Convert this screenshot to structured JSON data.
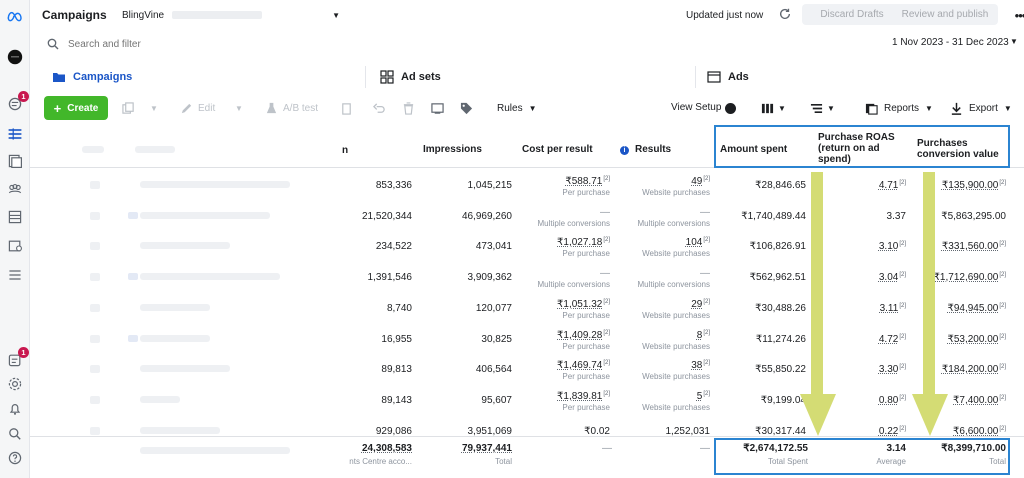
{
  "app": {
    "title": "Campaigns",
    "account": "BlingVine",
    "updated": "Updated just now",
    "discard": "Discard Drafts",
    "review": "Review and publish",
    "colors": {
      "accent": "#1b56c7",
      "create": "#42b72a",
      "highlight": "#2b84d1",
      "arrow": "#d4dc74"
    }
  },
  "sidebar": {
    "notif_badge": "1",
    "bottom_badge": "1"
  },
  "search": {
    "placeholder": "Search and filter",
    "daterange": "1 Nov 2023 - 31 Dec 2023"
  },
  "tabs": [
    {
      "label": "Campaigns"
    },
    {
      "label": "Ad sets"
    },
    {
      "label": "Ads"
    }
  ],
  "toolbar": {
    "create": "Create",
    "edit": "Edit",
    "abtest": "A/B test",
    "rules": "Rules",
    "view_setup": "View Setup",
    "reports": "Reports",
    "export": "Export"
  },
  "table": {
    "headers": {
      "partial": "n",
      "impressions": "Impressions",
      "cpr": "Cost per result",
      "results": "Results",
      "amount": "Amount spent",
      "roas_1": "Purchase ROAS",
      "roas_2": "(return on ad",
      "roas_3": "spend)",
      "pcv_1": "Purchases",
      "pcv_2": "conversion value"
    },
    "rows": [
      {
        "reach": "853,336",
        "impressions": "1,045,215",
        "cpr": "₹588.71",
        "cpr_note": "[2]",
        "cpr_sub": "Per purchase",
        "results": "49",
        "results_note": "[2]",
        "results_sub": "Website purchases",
        "amount": "₹28,846.65",
        "roas": "4.71",
        "roas_note": "[2]",
        "pcv": "₹135,900.00",
        "pcv_note": "[2]"
      },
      {
        "reach": "21,520,344",
        "impressions": "46,969,260",
        "cpr": "—",
        "cpr_note": "",
        "cpr_sub": "Multiple conversions",
        "results": "—",
        "results_note": "",
        "results_sub": "Multiple conversions",
        "amount": "₹1,740,489.44",
        "roas": "3.37",
        "roas_note": "",
        "pcv": "₹5,863,295.00",
        "pcv_note": ""
      },
      {
        "reach": "234,522",
        "impressions": "473,041",
        "cpr": "₹1,027.18",
        "cpr_note": "[2]",
        "cpr_sub": "Per purchase",
        "results": "104",
        "results_note": "[2]",
        "results_sub": "Website purchases",
        "amount": "₹106,826.91",
        "roas": "3.10",
        "roas_note": "[2]",
        "pcv": "₹331,560.00",
        "pcv_note": "[2]"
      },
      {
        "reach": "1,391,546",
        "impressions": "3,909,362",
        "cpr": "—",
        "cpr_note": "",
        "cpr_sub": "Multiple conversions",
        "results": "—",
        "results_note": "",
        "results_sub": "Multiple conversions",
        "amount": "₹562,962.51",
        "roas": "3.04",
        "roas_note": "[2]",
        "pcv": "₹1,712,690.00",
        "pcv_note": "[2]"
      },
      {
        "reach": "8,740",
        "impressions": "120,077",
        "cpr": "₹1,051.32",
        "cpr_note": "[2]",
        "cpr_sub": "Per purchase",
        "results": "29",
        "results_note": "[2]",
        "results_sub": "Website purchases",
        "amount": "₹30,488.26",
        "roas": "3.11",
        "roas_note": "[2]",
        "pcv": "₹94,945.00",
        "pcv_note": "[2]"
      },
      {
        "reach": "16,955",
        "impressions": "30,825",
        "cpr": "₹1,409.28",
        "cpr_note": "[2]",
        "cpr_sub": "Per purchase",
        "results": "8",
        "results_note": "[2]",
        "results_sub": "Website purchases",
        "amount": "₹11,274.26",
        "roas": "4.72",
        "roas_note": "[2]",
        "pcv": "₹53,200.00",
        "pcv_note": "[2]"
      },
      {
        "reach": "89,813",
        "impressions": "406,564",
        "cpr": "₹1,469.74",
        "cpr_note": "[2]",
        "cpr_sub": "Per purchase",
        "results": "38",
        "results_note": "[2]",
        "results_sub": "Website purchases",
        "amount": "₹55,850.22",
        "roas": "3.30",
        "roas_note": "[2]",
        "pcv": "₹184,200.00",
        "pcv_note": "[2]"
      },
      {
        "reach": "89,143",
        "impressions": "95,607",
        "cpr": "₹1,839.81",
        "cpr_note": "[2]",
        "cpr_sub": "Per purchase",
        "results": "5",
        "results_note": "[2]",
        "results_sub": "Website purchases",
        "amount": "₹9,199.04",
        "roas": "0.80",
        "roas_note": "[2]",
        "pcv": "₹7,400.00",
        "pcv_note": "[2]"
      },
      {
        "reach": "929,086",
        "impressions": "3,951,069",
        "cpr": "₹0.02",
        "cpr_note": "",
        "cpr_sub": "",
        "results": "1,252,031",
        "results_note": "",
        "results_sub": "",
        "amount": "₹30,317.44",
        "roas": "0.22",
        "roas_note": "[2]",
        "pcv": "₹6,600.00",
        "pcv_note": "[2]"
      }
    ],
    "totals": {
      "reach": "24,308,583",
      "reach_sub": "nts Centre acco...",
      "impressions": "79,937,441",
      "impressions_sub": "Total",
      "cpr": "—",
      "results": "—",
      "amount": "₹2,674,172.55",
      "amount_sub": "Total Spent",
      "roas": "3.14",
      "roas_sub": "Average",
      "pcv": "₹8,399,710.00",
      "pcv_sub": "Total"
    }
  }
}
